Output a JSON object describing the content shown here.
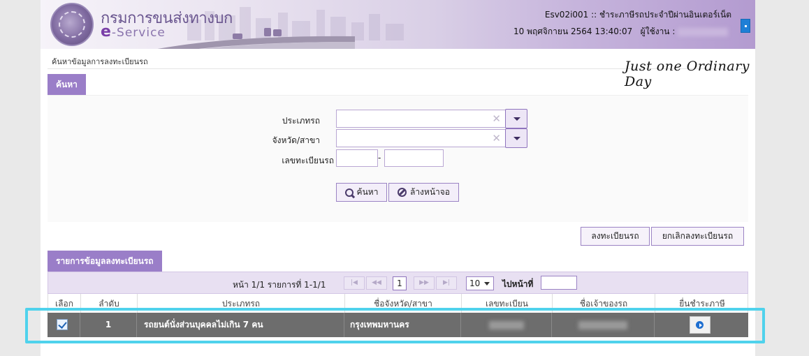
{
  "header": {
    "brand_th": "กรมการขนส่งทางบก",
    "brand_en_prefix": "e",
    "brand_en_suffix": "-Service",
    "system_title": "Esv02i001 :: ชำระภาษีรถประจำปีผ่านอินเตอร์เน็ต",
    "datetime": "10 พฤศจิกายน 2564 13:40:07",
    "user_label": "ผู้ใช้งาน :"
  },
  "annotation_text": "Just one Ordinary Day",
  "breadcrumb": "ค้นหาข้อมูลการลงทะเบียนรถ",
  "search": {
    "tab_label": "ค้นหา",
    "vehicle_type_label": "ประเภทรถ",
    "province_label": "จังหวัด/สาขา",
    "plate_label": "เลขทะเบียนรถ",
    "plate_separator": "-",
    "search_button": "ค้นหา",
    "clear_button": "ล้างหน้าจอ",
    "clear_x": "✕"
  },
  "actions": {
    "register_button": "ลงทะเบียนรถ",
    "cancel_register_button": "ยกเลิกลงทะเบียนรถ"
  },
  "list": {
    "tab_label": "รายการข้อมูลลงทะเบียนรถ",
    "pager_text": "หน้า 1/1 รายการที่ 1-1/1",
    "first_icon": "|◀",
    "prev_icon": "◀◀",
    "next_icon": "▶▶",
    "last_icon": "▶|",
    "current_page": "1",
    "page_size": "10",
    "goto_label": "ไปหน้าที่",
    "columns": [
      "เลือก",
      "ลำดับ",
      "ประเภทรถ",
      "ชื่อจังหวัด/สาขา",
      "เลขทะเบียน",
      "ชื่อเจ้าของรถ",
      "ยื่นชำระภาษี"
    ],
    "rows": [
      {
        "selected": true,
        "index": "1",
        "vehicle_type": "รถยนต์นั่งส่วนบุคคลไม่เกิน 7 คน",
        "province": "กรุงเทพมหานคร"
      }
    ]
  }
}
